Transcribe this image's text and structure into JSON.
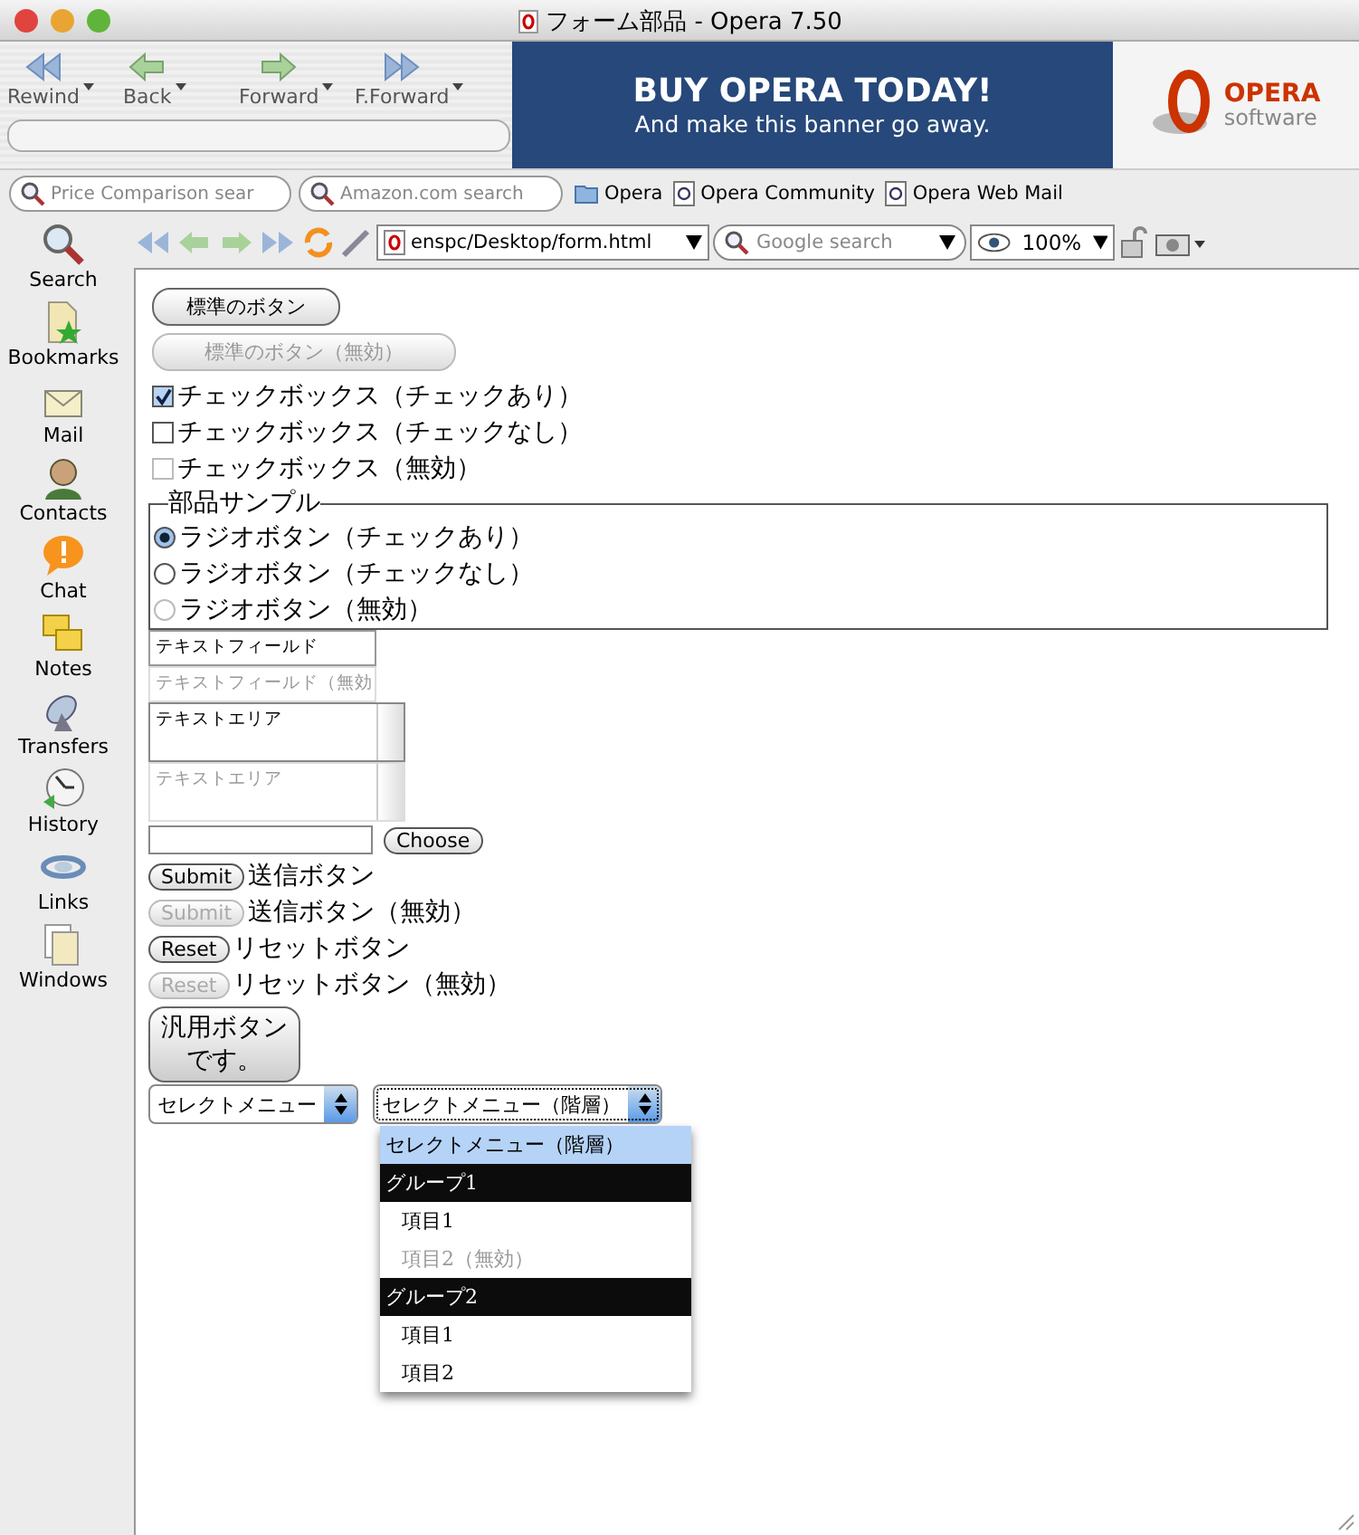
{
  "window": {
    "title": "フォーム部品 - Opera 7.50"
  },
  "nav_buttons": [
    {
      "label": "Rewind"
    },
    {
      "label": "Back"
    },
    {
      "label": "Forward"
    },
    {
      "label": "F.Forward"
    }
  ],
  "banner": {
    "headline": "BUY OPERA TODAY!",
    "subline": "And make this banner go away."
  },
  "logo": {
    "name": "OPERA",
    "sub": "software"
  },
  "personal_bar": {
    "search_fields": [
      {
        "placeholder": "Price Comparison sear"
      },
      {
        "placeholder": "Amazon.com search"
      }
    ],
    "links": [
      {
        "label": "Opera",
        "kind": "folder"
      },
      {
        "label": "Opera Community",
        "kind": "page"
      },
      {
        "label": "Opera Web Mail",
        "kind": "page"
      }
    ]
  },
  "sidebar": {
    "items": [
      {
        "label": "Search"
      },
      {
        "label": "Bookmarks"
      },
      {
        "label": "Mail"
      },
      {
        "label": "Contacts"
      },
      {
        "label": "Chat"
      },
      {
        "label": "Notes"
      },
      {
        "label": "Transfers"
      },
      {
        "label": "History"
      },
      {
        "label": "Links"
      },
      {
        "label": "Windows"
      }
    ]
  },
  "address_bar": {
    "url": "enspc/Desktop/form.html",
    "search_placeholder": "Google search",
    "zoom": "100%"
  },
  "form": {
    "buttons": [
      {
        "label": "標準のボタン",
        "disabled": false
      },
      {
        "label": "標準のボタン（無効）",
        "disabled": true
      }
    ],
    "checkboxes": [
      {
        "label": "チェックボックス（チェックあり）",
        "checked": true,
        "disabled": false
      },
      {
        "label": "チェックボックス（チェックなし）",
        "checked": false,
        "disabled": false
      },
      {
        "label": "チェックボックス（無効）",
        "checked": false,
        "disabled": true
      }
    ],
    "fieldset": {
      "legend": "部品サンプル",
      "radios": [
        {
          "label": "ラジオボタン（チェックあり）",
          "selected": true,
          "disabled": false
        },
        {
          "label": "ラジオボタン（チェックなし）",
          "selected": false,
          "disabled": false
        },
        {
          "label": "ラジオボタン（無効）",
          "selected": false,
          "disabled": true
        }
      ]
    },
    "text_fields": [
      {
        "value": "テキストフィールド",
        "disabled": false
      },
      {
        "value": "テキストフィールド（無効",
        "disabled": true
      }
    ],
    "text_areas": [
      {
        "value": "テキストエリア",
        "disabled": false
      },
      {
        "value": "テキストエリア",
        "disabled": true
      }
    ],
    "file_button": "Choose",
    "action_rows": [
      {
        "button": "Submit",
        "label": "送信ボタン",
        "disabled": false
      },
      {
        "button": "Submit",
        "label": "送信ボタン（無効）",
        "disabled": true
      },
      {
        "button": "Reset",
        "label": "リセットボタン",
        "disabled": false
      },
      {
        "button": "Reset",
        "label": "リセットボタン（無効）",
        "disabled": true
      }
    ],
    "generic_button": "汎用ボタンです。",
    "selects": [
      {
        "value": "セレクトメニュー",
        "expanded": false
      },
      {
        "value": "セレクトメニュー（階層）",
        "expanded": true
      }
    ],
    "dropdown_options": [
      {
        "kind": "option",
        "label": "セレクトメニュー（階層）",
        "selected": true,
        "disabled": false
      },
      {
        "kind": "group",
        "label": "グループ1"
      },
      {
        "kind": "option",
        "label": "項目1",
        "selected": false,
        "disabled": false
      },
      {
        "kind": "option",
        "label": "項目2（無効）",
        "selected": false,
        "disabled": true
      },
      {
        "kind": "group",
        "label": "グループ2"
      },
      {
        "kind": "option",
        "label": "項目1",
        "selected": false,
        "disabled": false
      },
      {
        "kind": "option",
        "label": "項目2",
        "selected": false,
        "disabled": false
      }
    ]
  }
}
